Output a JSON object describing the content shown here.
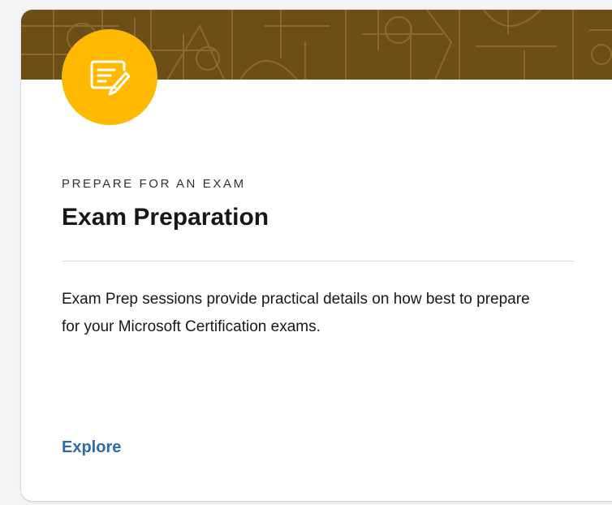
{
  "card": {
    "eyebrow": "PREPARE FOR AN EXAM",
    "title": "Exam Preparation",
    "description": "Exam Prep sessions provide practical details on how best to prepare for your Microsoft Certification exams.",
    "link_label": "Explore",
    "icon": "certificate-edit-icon"
  },
  "colors": {
    "banner": "#6b4f17",
    "icon_circle": "#ffb900",
    "link": "#2b6cb0"
  }
}
